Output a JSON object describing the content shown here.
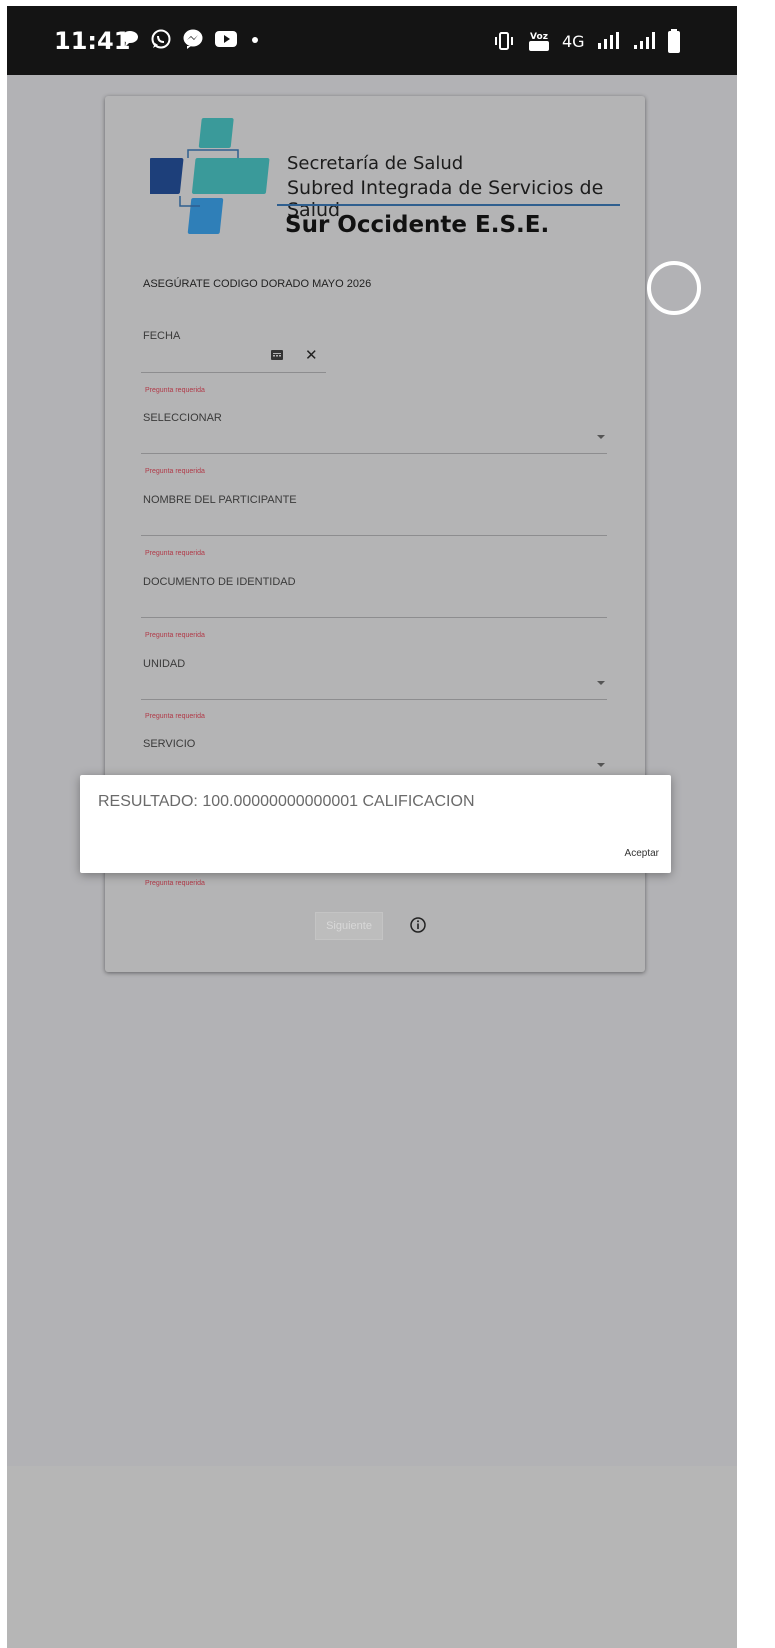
{
  "status_bar": {
    "time": "11:41",
    "left_icons": [
      "chat-bubble-icon",
      "whatsapp-icon",
      "messenger-icon",
      "youtube-icon",
      "dot-icon"
    ],
    "right_icons": [
      "vibrate-icon",
      "volte-icon",
      "network-4g-icon",
      "signal-icon",
      "signal-icon",
      "battery-icon"
    ],
    "network_label": "4G",
    "volte_label": "Voz"
  },
  "logo": {
    "line1": "Secretaría de Salud",
    "line2": "Subred Integrada de Servicios de Salud",
    "line3": "Sur Occidente E.S.E."
  },
  "form": {
    "title": "ASEGÚRATE CODIGO DORADO MAYO 2026",
    "required_text": "Pregunta requerida",
    "fields": [
      {
        "label": "FECHA"
      },
      {
        "label": "SELECCIONAR"
      },
      {
        "label": "NOMBRE DEL PARTICIPANTE"
      },
      {
        "label": "DOCUMENTO DE IDENTIDAD"
      },
      {
        "label": "UNIDAD"
      },
      {
        "label": "SERVICIO"
      }
    ],
    "next_label": "Siguiente"
  },
  "dialog": {
    "message": "RESULTADO: 100.00000000000001 CALIFICACION",
    "ok_label": "Aceptar"
  },
  "colors": {
    "overlay": "#b2b2b5",
    "required": "#b13a48",
    "logo_teal": "#3a9a9a",
    "logo_navy": "#1d3f7a",
    "logo_blue": "#2f7fb8"
  }
}
